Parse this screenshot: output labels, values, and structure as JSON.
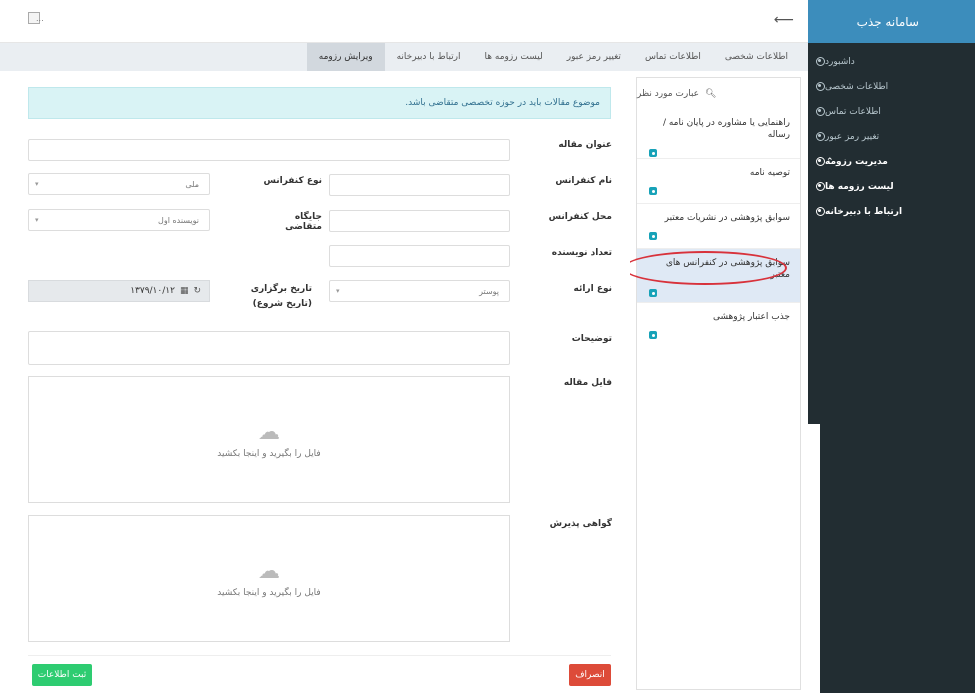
{
  "sidebar": {
    "brand": "سامانه جذب",
    "items": [
      {
        "label": "داشبورد"
      },
      {
        "label": "اطلاعات شخصی"
      },
      {
        "label": "اطلاعات تماس"
      },
      {
        "label": "تغییر رمز عبور"
      },
      {
        "label": "مدیریت رزومه"
      },
      {
        "label": "لیست رزومه ها"
      },
      {
        "label": "ارتباط با دبیرخانه"
      }
    ]
  },
  "topbar": {
    "avatar_text": "..."
  },
  "tabs": [
    {
      "label": "اطلاعات شخصی"
    },
    {
      "label": "اطلاعات تماس"
    },
    {
      "label": "تغییر رمز عبور"
    },
    {
      "label": "لیست رزومه ها"
    },
    {
      "label": "ارتباط با دبیرخانه"
    },
    {
      "label": "ویرایش رزومه"
    }
  ],
  "search": {
    "placeholder": "عبارت مورد نظر"
  },
  "list": [
    {
      "label": "راهنمایی یا مشاوره در پایان نامه / رساله"
    },
    {
      "label": "توصیه نامه"
    },
    {
      "label": "سوابق پژوهشی در نشریات معتبر"
    },
    {
      "label": "سوابق پژوهشی در کنفرانس های معتبر"
    },
    {
      "label": "جذب اعتبار پژوهشی"
    }
  ],
  "form": {
    "alert": "موضوع مقالات باید در حوزه تخصصی متقاضی باشد.",
    "title_label": "عنوان مقاله",
    "conf_name_label": "نام کنفرانس",
    "conf_type_label": "نوع کنفرانس",
    "conf_type_value": "ملی",
    "conf_place_label": "محل کنفرانس",
    "applicant_pos_label": "جایگاه متقاضی",
    "applicant_pos_value": "نویسنده اول",
    "authors_label": "تعداد نویسنده",
    "authors_value": "",
    "present_type_label": "نوع ارائه",
    "present_type_value": "پوستر",
    "date_label": "تاریخ برگزاری (تاریخ شروع)",
    "date_value": "۱۳۷۹/۱۰/۱۲",
    "desc_label": "توضیحات",
    "file_label": "فایل مقاله",
    "file_drop": "فایل را بگیرید و اینجا بکشید",
    "cert_label": "گواهی پذیرش",
    "cert_drop": "فایل را بگیرید و اینجا بکشید",
    "cancel": "انصراف",
    "save": "ثبت اطلاعات"
  },
  "colors": {
    "sidebar": "#222d32",
    "brand": "#3c8dbc",
    "cancel": "#dd4b39",
    "save": "#2ecc71",
    "highlight": "#d8323b"
  }
}
